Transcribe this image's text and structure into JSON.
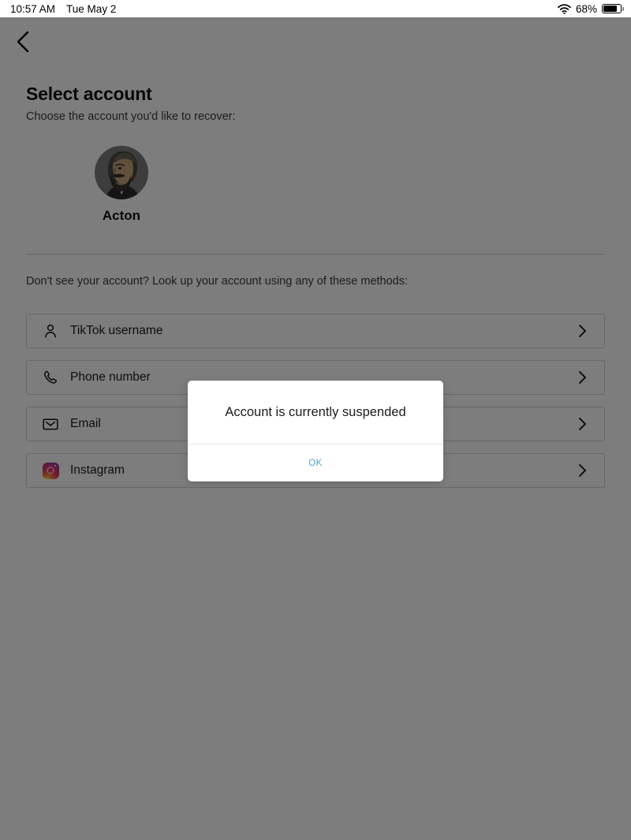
{
  "status_bar": {
    "time": "10:57 AM",
    "date": "Tue May 2",
    "wifi_icon": "wifi-icon",
    "battery_percent": "68%",
    "battery_icon": "battery-icon"
  },
  "nav": {
    "back_icon": "chevron-left-icon"
  },
  "header": {
    "title": "Select account",
    "subtitle": "Choose the account you'd like to recover:"
  },
  "account": {
    "avatar_icon": "user-avatar-bearded-man",
    "name": "Acton"
  },
  "methods": {
    "label": "Don't see your account? Look up your account using any of these methods:",
    "items": [
      {
        "label": "TikTok username",
        "icon": "person-icon",
        "chevron": "chevron-right-icon"
      },
      {
        "label": "Phone number",
        "icon": "phone-icon",
        "chevron": "chevron-right-icon"
      },
      {
        "label": "Email",
        "icon": "envelope-icon",
        "chevron": "chevron-right-icon"
      },
      {
        "label": "Instagram",
        "icon": "instagram-icon",
        "chevron": "chevron-right-icon"
      }
    ]
  },
  "dialog": {
    "message": "Account is currently suspended",
    "ok_label": "OK"
  },
  "colors": {
    "page_background": "#ffffff",
    "dim_overlay": "rgba(0,0,0,0.51)",
    "dialog_background": "#ffffff",
    "ok_accent": "#4fa3d1",
    "text_primary": "#111111",
    "text_secondary": "#3c3c3c",
    "row_border": "#d2d2d2"
  }
}
